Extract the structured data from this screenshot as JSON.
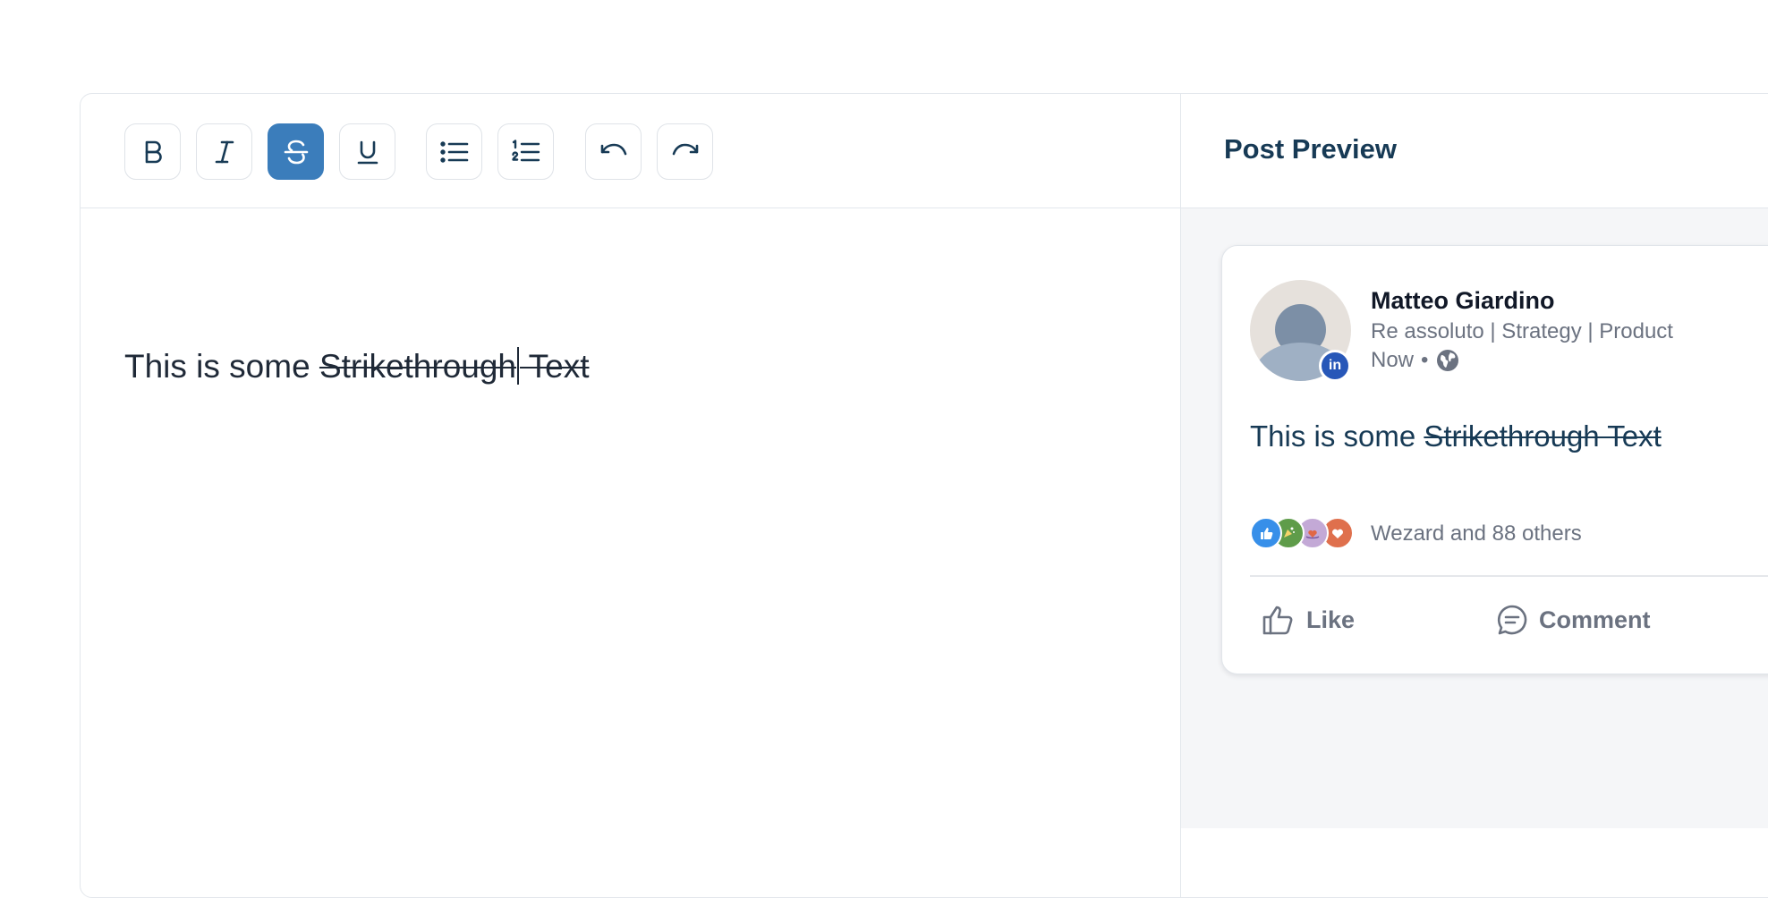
{
  "toolbar": {
    "buttons": [
      {
        "name": "bold",
        "icon": "bold-icon",
        "active": false
      },
      {
        "name": "italic",
        "icon": "italic-icon",
        "active": false
      },
      {
        "name": "strikethrough",
        "icon": "strikethrough-icon",
        "active": true
      },
      {
        "name": "underline",
        "icon": "underline-icon",
        "active": false
      },
      {
        "name": "bullet-list",
        "icon": "bullet-list-icon",
        "active": false
      },
      {
        "name": "numbered-list",
        "icon": "numbered-list-icon",
        "active": false
      },
      {
        "name": "undo",
        "icon": "undo-icon",
        "active": false
      },
      {
        "name": "redo",
        "icon": "redo-icon",
        "active": false
      }
    ],
    "active_color": "#3b7dbb"
  },
  "editor": {
    "plain_text": "This is some ",
    "strike_text_part1": "Strikethrough",
    "strike_text_part2": " Text"
  },
  "preview": {
    "title": "Post Preview",
    "author": {
      "name": "Matteo Giardino",
      "headline": "Re assoluto | Strategy | Product",
      "time": "Now",
      "separator": "•",
      "badge": "in",
      "visibility_icon": "globe-icon"
    },
    "post": {
      "plain_text": "This is some ",
      "strike_text": "Strikethrough Text "
    },
    "reactions": {
      "icons": [
        "like-icon",
        "celebrate-icon",
        "support-icon",
        "love-icon"
      ],
      "summary": "Wezard and 88 others"
    },
    "actions": {
      "like_label": "Like",
      "comment_label": "Comment"
    }
  },
  "colors": {
    "title": "#173a55",
    "border": "#e3e7ec",
    "preview_background": "#f5f6f8",
    "linkedin_blue": "#2757b8"
  }
}
